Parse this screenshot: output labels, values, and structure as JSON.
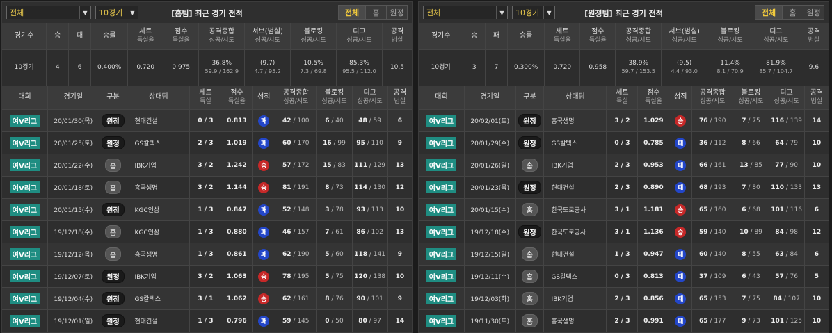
{
  "panels": [
    {
      "league_select": "전체",
      "games_select": "10경기",
      "title": "[홈팀] 최근 경기 전적",
      "tabs": [
        "전체",
        "홈",
        "원정"
      ],
      "summary_headers": [
        [
          "경기수",
          ""
        ],
        [
          "승",
          ""
        ],
        [
          "패",
          ""
        ],
        [
          "승률",
          ""
        ],
        [
          "세트",
          "득실율"
        ],
        [
          "점수",
          "득실율"
        ],
        [
          "공격종합",
          "성공/시도"
        ],
        [
          "서브(범실)",
          "성공/시도"
        ],
        [
          "블로킹",
          "성공/시도"
        ],
        [
          "디그",
          "성공/시도"
        ],
        [
          "공격",
          "범실"
        ]
      ],
      "summary": {
        "games": "10경기",
        "win": "4",
        "loss": "6",
        "rate": "0.400%",
        "set": "0.720",
        "point": "0.975",
        "attack": "36.8%",
        "attack_sub": "59.9 / 162.9",
        "serve": "(9.7)",
        "serve_sub": "4.7 / 95.2",
        "block": "10.5%",
        "block_sub": "7.3 / 69.8",
        "dig": "85.3%",
        "dig_sub": "95.5 / 112.0",
        "err": "10.5"
      },
      "detail_headers": [
        [
          "대회",
          ""
        ],
        [
          "경기일",
          ""
        ],
        [
          "구분",
          ""
        ],
        [
          "상대팀",
          ""
        ],
        [
          "세트",
          "득실"
        ],
        [
          "점수",
          "득실율"
        ],
        [
          "성적",
          ""
        ],
        [
          "공격종합",
          "성공/시도"
        ],
        [
          "블로킹",
          "성공/시도"
        ],
        [
          "디그",
          "성공/시도"
        ],
        [
          "공격",
          "범실"
        ]
      ],
      "rows": [
        {
          "league": "여V리그",
          "date": "20/01/30(목)",
          "type": "원정",
          "ha": "away",
          "opp": "현대건설",
          "set": "0 / 3",
          "pt": "0.813",
          "res": "패",
          "rc": "l",
          "atk1": "42",
          "atk2": "/ 100",
          "blk1": "6",
          "blk2": "/ 40",
          "dig1": "48",
          "dig2": "/ 59",
          "err": "6"
        },
        {
          "league": "여V리그",
          "date": "20/01/25(토)",
          "type": "원정",
          "ha": "away",
          "opp": "GS칼텍스",
          "set": "2 / 3",
          "pt": "1.019",
          "res": "패",
          "rc": "l",
          "atk1": "60",
          "atk2": "/ 170",
          "blk1": "16",
          "blk2": "/ 99",
          "dig1": "95",
          "dig2": "/ 110",
          "err": "9"
        },
        {
          "league": "여V리그",
          "date": "20/01/22(수)",
          "type": "홈",
          "ha": "home",
          "opp": "IBK기업",
          "set": "3 / 2",
          "pt": "1.242",
          "res": "승",
          "rc": "w",
          "atk1": "57",
          "atk2": "/ 172",
          "blk1": "15",
          "blk2": "/ 83",
          "dig1": "111",
          "dig2": "/ 129",
          "err": "13"
        },
        {
          "league": "여V리그",
          "date": "20/01/18(토)",
          "type": "홈",
          "ha": "home",
          "opp": "흥국생명",
          "set": "3 / 2",
          "pt": "1.144",
          "res": "승",
          "rc": "w",
          "atk1": "81",
          "atk2": "/ 191",
          "blk1": "8",
          "blk2": "/ 73",
          "dig1": "114",
          "dig2": "/ 130",
          "err": "12"
        },
        {
          "league": "여V리그",
          "date": "20/01/15(수)",
          "type": "원정",
          "ha": "away",
          "opp": "KGC인삼",
          "set": "1 / 3",
          "pt": "0.847",
          "res": "패",
          "rc": "l",
          "atk1": "52",
          "atk2": "/ 148",
          "blk1": "3",
          "blk2": "/ 78",
          "dig1": "93",
          "dig2": "/ 113",
          "err": "10"
        },
        {
          "league": "여V리그",
          "date": "19/12/18(수)",
          "type": "홈",
          "ha": "home",
          "opp": "KGC인삼",
          "set": "1 / 3",
          "pt": "0.880",
          "res": "패",
          "rc": "l",
          "atk1": "46",
          "atk2": "/ 157",
          "blk1": "7",
          "blk2": "/ 61",
          "dig1": "86",
          "dig2": "/ 102",
          "err": "13"
        },
        {
          "league": "여V리그",
          "date": "19/12/12(목)",
          "type": "홈",
          "ha": "home",
          "opp": "흥국생명",
          "set": "1 / 3",
          "pt": "0.861",
          "res": "패",
          "rc": "l",
          "atk1": "62",
          "atk2": "/ 190",
          "blk1": "5",
          "blk2": "/ 60",
          "dig1": "118",
          "dig2": "/ 141",
          "err": "9"
        },
        {
          "league": "여V리그",
          "date": "19/12/07(토)",
          "type": "원정",
          "ha": "away",
          "opp": "IBK기업",
          "set": "3 / 2",
          "pt": "1.063",
          "res": "승",
          "rc": "w",
          "atk1": "78",
          "atk2": "/ 195",
          "blk1": "5",
          "blk2": "/ 75",
          "dig1": "120",
          "dig2": "/ 138",
          "err": "10"
        },
        {
          "league": "여V리그",
          "date": "19/12/04(수)",
          "type": "원정",
          "ha": "away",
          "opp": "GS칼텍스",
          "set": "3 / 1",
          "pt": "1.062",
          "res": "승",
          "rc": "w",
          "atk1": "62",
          "atk2": "/ 161",
          "blk1": "8",
          "blk2": "/ 76",
          "dig1": "90",
          "dig2": "/ 101",
          "err": "9"
        },
        {
          "league": "여V리그",
          "date": "19/12/01(일)",
          "type": "원정",
          "ha": "away",
          "opp": "현대건설",
          "set": "1 / 3",
          "pt": "0.796",
          "res": "패",
          "rc": "l",
          "atk1": "59",
          "atk2": "/ 145",
          "blk1": "0",
          "blk2": "/ 50",
          "dig1": "80",
          "dig2": "/ 97",
          "err": "14"
        }
      ]
    },
    {
      "league_select": "전체",
      "games_select": "10경기",
      "title": "[원정팀] 최근 경기 전적",
      "tabs": [
        "전체",
        "홈",
        "원정"
      ],
      "summary_headers": [
        [
          "경기수",
          ""
        ],
        [
          "승",
          ""
        ],
        [
          "패",
          ""
        ],
        [
          "승률",
          ""
        ],
        [
          "세트",
          "득실율"
        ],
        [
          "점수",
          "득실율"
        ],
        [
          "공격종합",
          "성공/시도"
        ],
        [
          "서브(범실)",
          "성공/시도"
        ],
        [
          "블로킹",
          "성공/시도"
        ],
        [
          "디그",
          "성공/시도"
        ],
        [
          "공격",
          "범실"
        ]
      ],
      "summary": {
        "games": "10경기",
        "win": "3",
        "loss": "7",
        "rate": "0.300%",
        "set": "0.720",
        "point": "0.958",
        "attack": "38.9%",
        "attack_sub": "59.7 / 153.5",
        "serve": "(9.5)",
        "serve_sub": "4.4 / 93.0",
        "block": "11.4%",
        "block_sub": "8.1 / 70.9",
        "dig": "81.9%",
        "dig_sub": "85.7 / 104.7",
        "err": "9.6"
      },
      "detail_headers": [
        [
          "대회",
          ""
        ],
        [
          "경기일",
          ""
        ],
        [
          "구분",
          ""
        ],
        [
          "상대팀",
          ""
        ],
        [
          "세트",
          "득실"
        ],
        [
          "점수",
          "득실율"
        ],
        [
          "성적",
          ""
        ],
        [
          "공격종합",
          "성공/시도"
        ],
        [
          "블로킹",
          "성공/시도"
        ],
        [
          "디그",
          "성공/시도"
        ],
        [
          "공격",
          "범실"
        ]
      ],
      "rows": [
        {
          "league": "여V리그",
          "date": "20/02/01(토)",
          "type": "원정",
          "ha": "away",
          "opp": "흥국생명",
          "set": "3 / 2",
          "pt": "1.029",
          "res": "승",
          "rc": "w",
          "atk1": "76",
          "atk2": "/ 190",
          "blk1": "7",
          "blk2": "/ 75",
          "dig1": "116",
          "dig2": "/ 139",
          "err": "14"
        },
        {
          "league": "여V리그",
          "date": "20/01/29(수)",
          "type": "원정",
          "ha": "away",
          "opp": "GS칼텍스",
          "set": "0 / 3",
          "pt": "0.785",
          "res": "패",
          "rc": "l",
          "atk1": "36",
          "atk2": "/ 112",
          "blk1": "8",
          "blk2": "/ 66",
          "dig1": "64",
          "dig2": "/ 79",
          "err": "10"
        },
        {
          "league": "여V리그",
          "date": "20/01/26(일)",
          "type": "홈",
          "ha": "home",
          "opp": "IBK기업",
          "set": "2 / 3",
          "pt": "0.953",
          "res": "패",
          "rc": "l",
          "atk1": "66",
          "atk2": "/ 161",
          "blk1": "13",
          "blk2": "/ 85",
          "dig1": "77",
          "dig2": "/ 90",
          "err": "10"
        },
        {
          "league": "여V리그",
          "date": "20/01/23(목)",
          "type": "원정",
          "ha": "away",
          "opp": "현대건설",
          "set": "2 / 3",
          "pt": "0.890",
          "res": "패",
          "rc": "l",
          "atk1": "68",
          "atk2": "/ 193",
          "blk1": "7",
          "blk2": "/ 80",
          "dig1": "110",
          "dig2": "/ 133",
          "err": "13"
        },
        {
          "league": "여V리그",
          "date": "20/01/15(수)",
          "type": "홈",
          "ha": "home",
          "opp": "한국도로공사",
          "set": "3 / 1",
          "pt": "1.181",
          "res": "승",
          "rc": "w",
          "atk1": "65",
          "atk2": "/ 160",
          "blk1": "6",
          "blk2": "/ 68",
          "dig1": "101",
          "dig2": "/ 116",
          "err": "6"
        },
        {
          "league": "여V리그",
          "date": "19/12/18(수)",
          "type": "원정",
          "ha": "away",
          "opp": "한국도로공사",
          "set": "3 / 1",
          "pt": "1.136",
          "res": "승",
          "rc": "w",
          "atk1": "59",
          "atk2": "/ 140",
          "blk1": "10",
          "blk2": "/ 89",
          "dig1": "84",
          "dig2": "/ 98",
          "err": "12"
        },
        {
          "league": "여V리그",
          "date": "19/12/15(일)",
          "type": "홈",
          "ha": "home",
          "opp": "현대건설",
          "set": "1 / 3",
          "pt": "0.947",
          "res": "패",
          "rc": "l",
          "atk1": "60",
          "atk2": "/ 140",
          "blk1": "8",
          "blk2": "/ 55",
          "dig1": "63",
          "dig2": "/ 84",
          "err": "6"
        },
        {
          "league": "여V리그",
          "date": "19/12/11(수)",
          "type": "홈",
          "ha": "home",
          "opp": "GS칼텍스",
          "set": "0 / 3",
          "pt": "0.813",
          "res": "패",
          "rc": "l",
          "atk1": "37",
          "atk2": "/ 109",
          "blk1": "6",
          "blk2": "/ 43",
          "dig1": "57",
          "dig2": "/ 76",
          "err": "5"
        },
        {
          "league": "여V리그",
          "date": "19/12/03(화)",
          "type": "홈",
          "ha": "home",
          "opp": "IBK기업",
          "set": "2 / 3",
          "pt": "0.856",
          "res": "패",
          "rc": "l",
          "atk1": "65",
          "atk2": "/ 153",
          "blk1": "7",
          "blk2": "/ 75",
          "dig1": "84",
          "dig2": "/ 107",
          "err": "10"
        },
        {
          "league": "여V리그",
          "date": "19/11/30(토)",
          "type": "홈",
          "ha": "home",
          "opp": "흥국생명",
          "set": "2 / 3",
          "pt": "0.991",
          "res": "패",
          "rc": "l",
          "atk1": "65",
          "atk2": "/ 177",
          "blk1": "9",
          "blk2": "/ 73",
          "dig1": "101",
          "dig2": "/ 125",
          "err": "10"
        }
      ]
    }
  ]
}
